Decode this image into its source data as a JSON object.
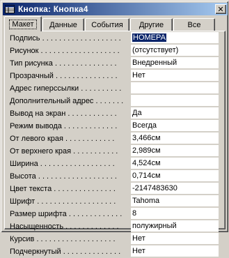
{
  "window": {
    "title": "Кнопка: Кнопка4",
    "close_label": "✕",
    "title_icon": "grid-sheet-icon"
  },
  "tabs": [
    {
      "label": "Макет",
      "active": true
    },
    {
      "label": "Данные",
      "active": false
    },
    {
      "label": "События",
      "active": false
    },
    {
      "label": "Другие",
      "active": false
    },
    {
      "label": "Все",
      "active": false
    }
  ],
  "properties": [
    {
      "label": "Подпись . . . . . . . . . . . . . . . . . . .",
      "value": "НОМЕРА",
      "selected": true
    },
    {
      "label": "Рисунок . . . . . . . . . . . . . . . . . . .",
      "value": "(отсутствует)"
    },
    {
      "label": "Тип рисунка . . . . . . . . . . . . . . .",
      "value": "Внедренный"
    },
    {
      "label": "Прозрачный . . . . . . . . . . . . . . .",
      "value": "Нет"
    },
    {
      "label": "Адрес гиперссылки . . . . . . . . . .",
      "value": ""
    },
    {
      "label": "Дополнительный адрес . . . . . . .",
      "value": ""
    },
    {
      "label": "Вывод на экран . . . . . . . . . . . .",
      "value": "Да"
    },
    {
      "label": "Режим вывода . . . . . . . . . . . . .",
      "value": "Всегда"
    },
    {
      "label": "От левого края . . . . . . . . . . . .",
      "value": "3,466см"
    },
    {
      "label": "От верхнего края . . . . . . . . . . .",
      "value": "2,989см"
    },
    {
      "label": "Ширина . . . . . . . . . . . . . . . . . .",
      "value": "4,524см"
    },
    {
      "label": "Высота . . . . . . . . . . . . . . . . . . .",
      "value": "0,714см"
    },
    {
      "label": "Цвет текста . . . . . . . . . . . . . . .",
      "value": "-2147483630"
    },
    {
      "label": "Шрифт . . . . . . . . . . . . . . . . . . .",
      "value": "Tahoma"
    },
    {
      "label": "Размер шрифта . . . . . . . . . . . . .",
      "value": "8"
    },
    {
      "label": "Насыщенность . . . . . . . . . . . . .",
      "value": "полужирный"
    },
    {
      "label": "Курсив . . . . . . . . . . . . . . . . . . .",
      "value": "Нет"
    },
    {
      "label": "Подчеркнутый . . . . . . . . . . . . . .",
      "value": "Нет"
    }
  ],
  "colors": {
    "titlebar_start": "#0a246a",
    "titlebar_end": "#a6caf0",
    "selection": "#0a246a",
    "face": "#d4d0c8"
  }
}
